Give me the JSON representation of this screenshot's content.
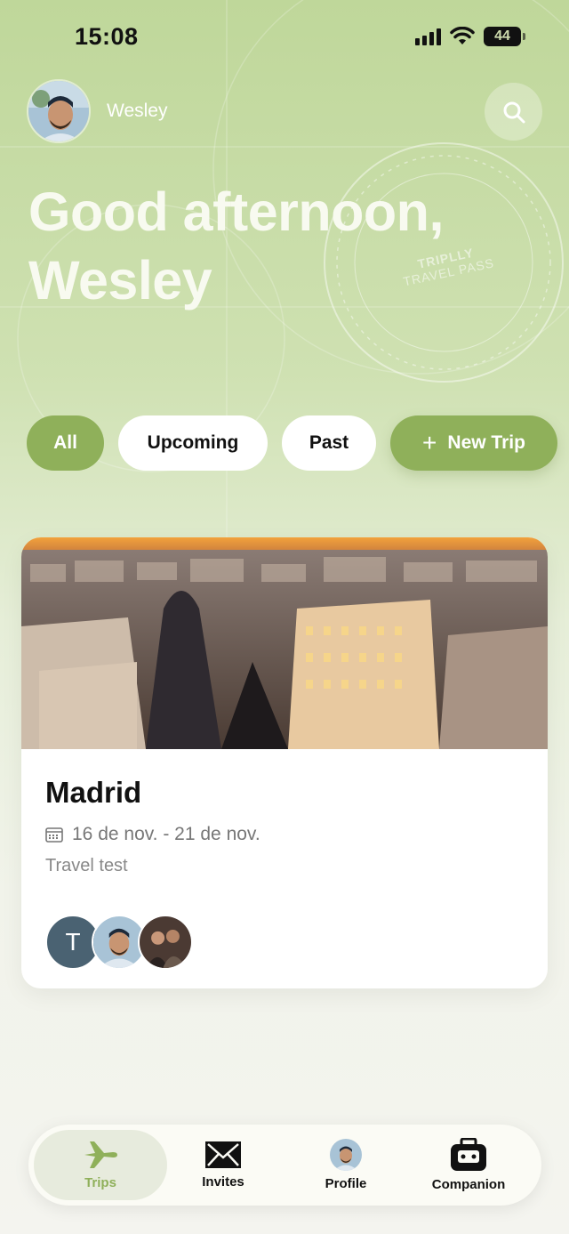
{
  "status_bar": {
    "time": "15:08",
    "battery": "44"
  },
  "user": {
    "name": "Wesley"
  },
  "greeting": "Good afternoon, Wesley",
  "stamp": {
    "line1": "TRIPLLY",
    "line2": "TRAVEL PASS"
  },
  "filters": {
    "all": "All",
    "upcoming": "Upcoming",
    "past": "Past",
    "new_trip": "New Trip",
    "active": "All"
  },
  "trips": [
    {
      "title": "Madrid",
      "dates": "16 de nov. - 21 de nov.",
      "description": "Travel test",
      "members": [
        "T"
      ]
    }
  ],
  "tabbar": {
    "trips": "Trips",
    "invites": "Invites",
    "profile": "Profile",
    "companion": "Companion",
    "active": "Trips"
  },
  "colors": {
    "accent": "#8fb05a",
    "background_top": "#bfd79a"
  }
}
